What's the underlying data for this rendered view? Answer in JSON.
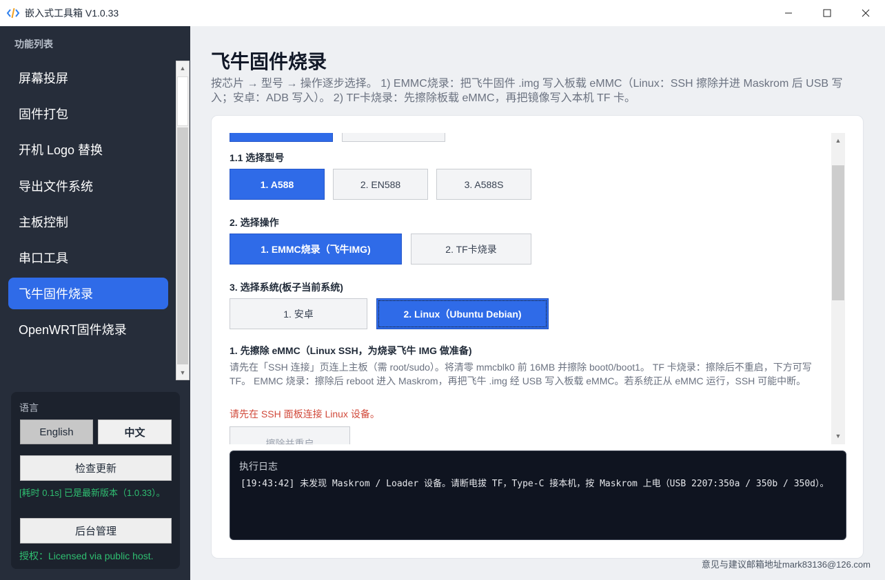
{
  "window": {
    "title": "嵌入式工具箱 V1.0.33",
    "controls": [
      "minimize",
      "maximize",
      "close"
    ]
  },
  "sidebar": {
    "header": "功能列表",
    "items": [
      {
        "label": "屏幕投屏",
        "active": false
      },
      {
        "label": "固件打包",
        "active": false
      },
      {
        "label": "开机 Logo 替换",
        "active": false
      },
      {
        "label": "导出文件系统",
        "active": false
      },
      {
        "label": "主板控制",
        "active": false
      },
      {
        "label": "串口工具",
        "active": false
      },
      {
        "label": "飞牛固件烧录",
        "active": true
      },
      {
        "label": "OpenWRT固件烧录",
        "active": false
      }
    ],
    "language": {
      "label": "语言",
      "english": "English",
      "chinese": "中文"
    },
    "update_button": "检查更新",
    "update_message": "[耗时 0.1s] 已是最新版本（1.0.33）。",
    "admin_button": "后台管理",
    "license": "授权：Licensed via public host."
  },
  "main": {
    "title": "飞牛固件烧录",
    "description": "按芯片 → 型号 → 操作逐步选择。 1) EMMC烧录：把飞牛固件 .img 写入板载 eMMC（Linux：SSH 擦除并进 Maskrom 后 USB 写入；安卓：ADB 写入）。 2) TF卡烧录：先擦除板载 eMMC，再把镜像写入本机 TF 卡。",
    "model": {
      "label": "1.1 选择型号",
      "options": [
        {
          "label": "1. A588",
          "selected": true
        },
        {
          "label": "2. EN588",
          "selected": false
        },
        {
          "label": "3. A588S",
          "selected": false
        }
      ]
    },
    "operation": {
      "label": "2. 选择操作",
      "options": [
        {
          "label": "1. EMMC烧录（飞牛IMG)",
          "selected": true
        },
        {
          "label": "2. TF卡烧录",
          "selected": false
        }
      ]
    },
    "system": {
      "label": "3. 选择系统(板子当前系统)",
      "options": [
        {
          "label": "1. 安卓",
          "selected": false
        },
        {
          "label": "2. Linux（Ubuntu Debian)",
          "selected": true
        }
      ]
    },
    "erase_step": {
      "title": "1. 先擦除 eMMC（Linux SSH，为烧录飞牛 IMG 做准备)",
      "description": "请先在「SSH 连接」页连上主板（需 root/sudo）。将清零 mmcblk0 前 16MB 并擦除 boot0/boot1。 TF 卡烧录：擦除后不重启，下方可写 TF。 EMMC 烧录：擦除后 reboot 进入 Maskrom，再把飞牛 .img 经 USB 写入板载 eMMC。若系统正从 eMMC 运行，SSH 可能中断。",
      "warning": "请先在 SSH 面板连接 Linux 设备。",
      "button": "擦除并重启"
    },
    "log": {
      "title": "执行日志",
      "line": "[19:43:42] 未发现 Maskrom / Loader 设备。请断电拔 TF，Type-C 接本机，按 Maskrom 上电（USB 2207:350a / 350b / 350d）。"
    },
    "footer": "意见与建议邮箱地址mark83136@126.com"
  },
  "colors": {
    "accent": "#2f6be8",
    "sidebar_bg": "#262d3a",
    "success": "#2fbf71",
    "warning": "#d14a3b",
    "log_bg": "#0f1420"
  }
}
